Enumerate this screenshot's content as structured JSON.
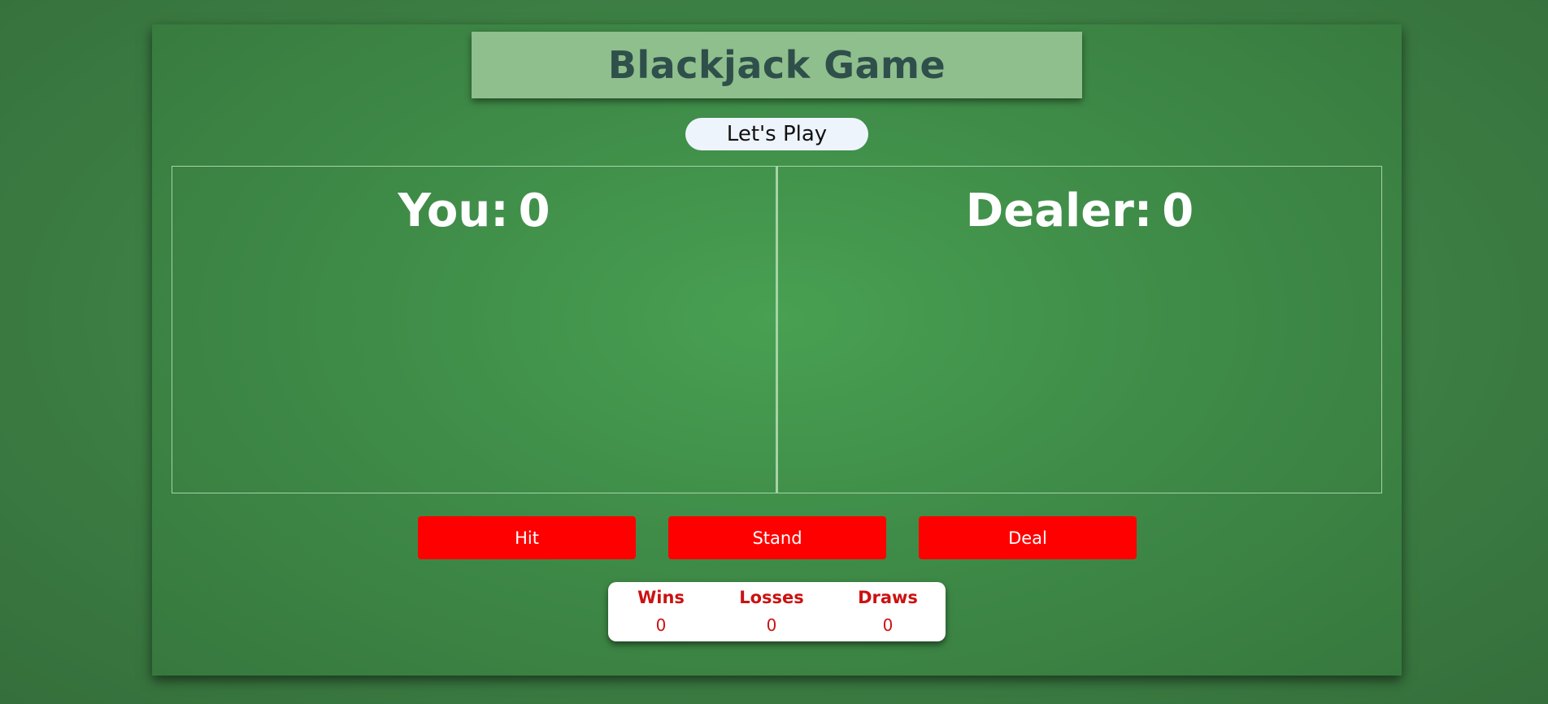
{
  "title": "Blackjack Game",
  "lets_play_label": "Let's Play",
  "player": {
    "label": "You:",
    "score": "0"
  },
  "dealer": {
    "label": "Dealer:",
    "score": "0"
  },
  "controls": {
    "hit_label": "Hit",
    "stand_label": "Stand",
    "deal_label": "Deal"
  },
  "stats": {
    "wins_label": "Wins",
    "wins_value": "0",
    "losses_label": "Losses",
    "losses_value": "0",
    "draws_label": "Draws",
    "draws_value": "0"
  },
  "colors": {
    "felt": "#3f8c48",
    "title_bg": "#8fbf8d",
    "title_text": "#2f4f4b",
    "button_bg": "#ff0000",
    "stat_text": "#cc1111"
  }
}
